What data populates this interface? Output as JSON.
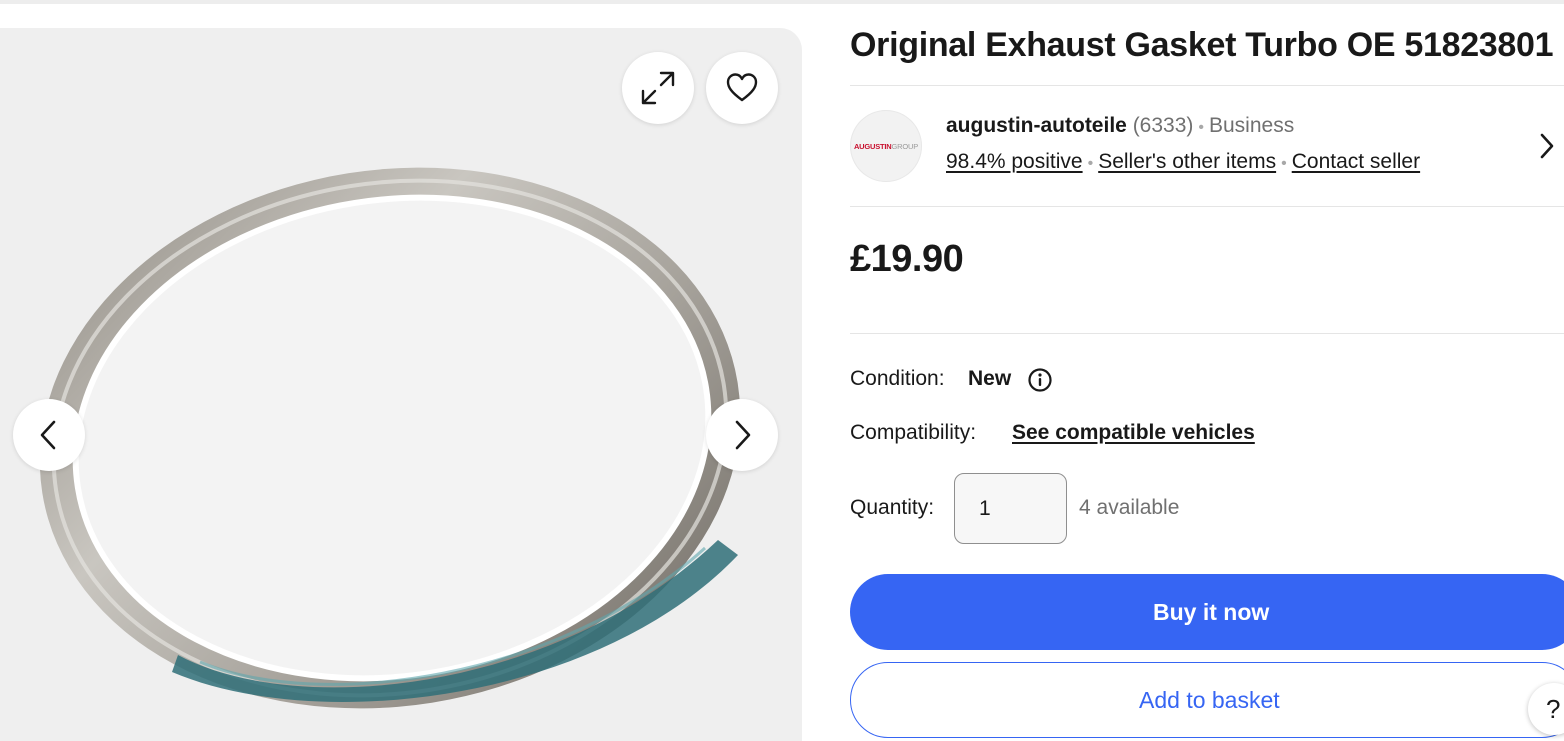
{
  "product": {
    "title": "Original Exhaust Gasket Turbo OE 51823801",
    "price": "£19.90"
  },
  "gallery": {
    "image_icon": "gasket-ring-photo",
    "expand_icon": "expand-icon",
    "favorite_icon": "heart-icon",
    "prev_icon": "chevron-left-icon",
    "next_icon": "chevron-right-icon"
  },
  "seller": {
    "logo_text_primary": "AUGUSTIN",
    "logo_text_secondary": "GROUP",
    "name": "augustin-autoteile",
    "feedback_count": "(6333)",
    "type": "Business",
    "positive": "98.4% positive",
    "other_items": "Seller's other items",
    "contact": "Contact seller"
  },
  "details": {
    "condition_label": "Condition:",
    "condition_value": "New",
    "compatibility_label": "Compatibility:",
    "compatibility_link": "See compatible vehicles",
    "quantity_label": "Quantity:",
    "quantity_value": "1",
    "available": "4 available"
  },
  "actions": {
    "buy_now": "Buy it now",
    "add_to_basket": "Add to basket",
    "help": "?"
  },
  "colors": {
    "accent": "#3665f3",
    "text": "#191919",
    "muted": "#707070",
    "gallery_bg": "#efefef"
  }
}
